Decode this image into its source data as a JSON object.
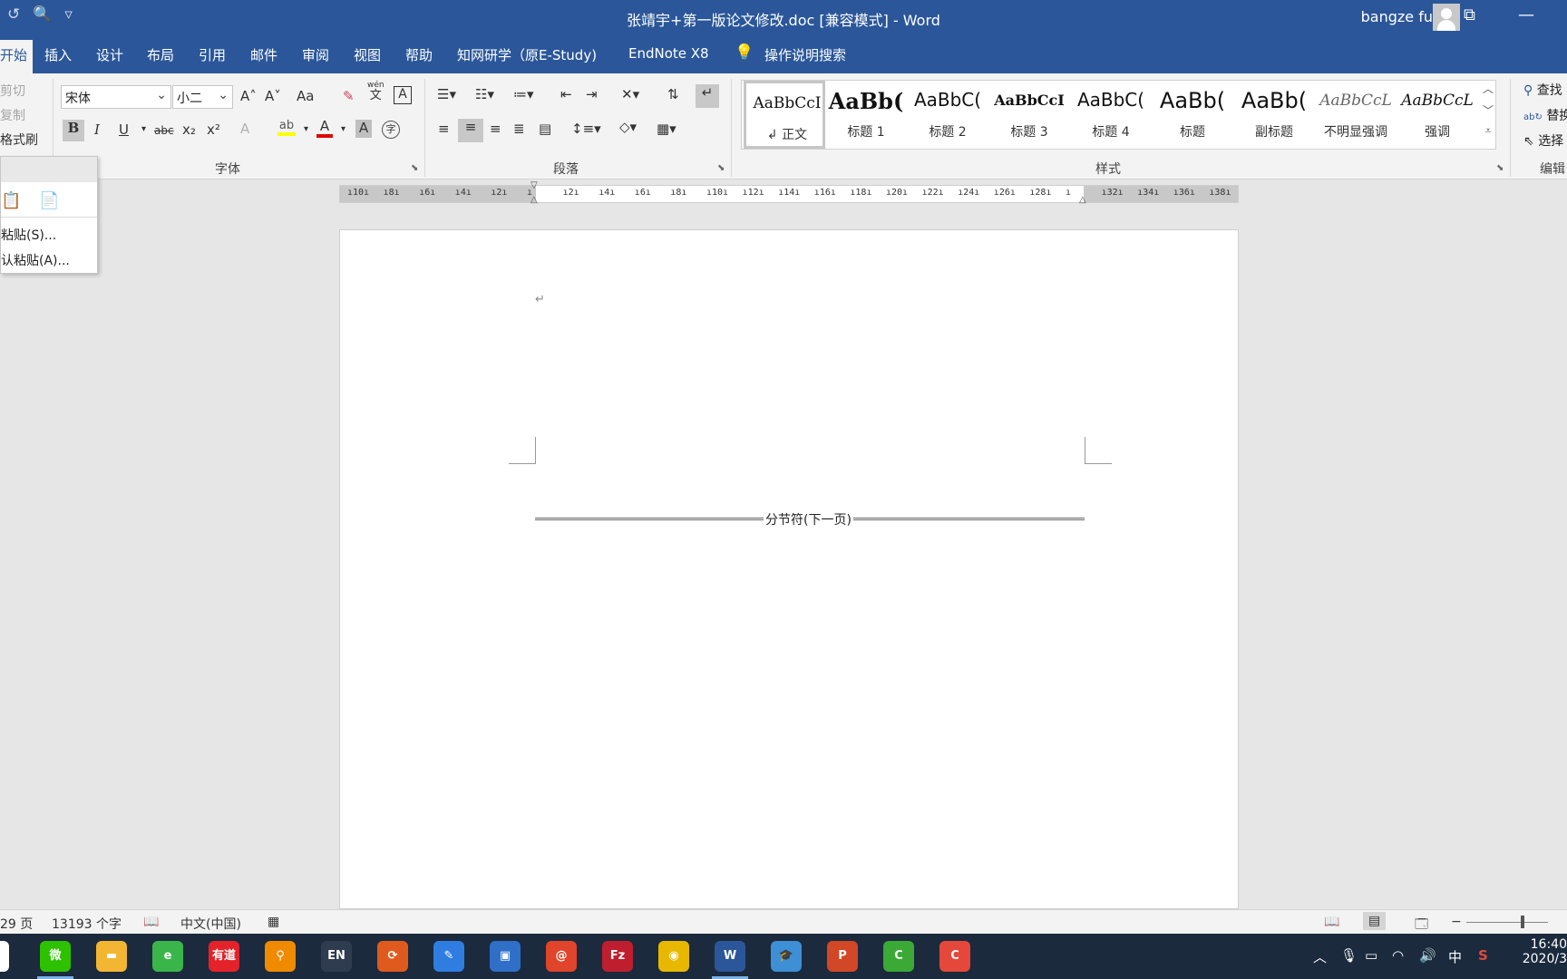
{
  "window": {
    "title": "张靖宇+第一版论文修改.doc [兼容模式]  -  Word",
    "user": "bangze fu",
    "restore_glyph": "⧉",
    "minimize_glyph": "—"
  },
  "qat": {
    "undo": "↺",
    "preview": "🔍",
    "more": "▿"
  },
  "tabs": {
    "home": "开始",
    "insert": "插入",
    "design": "设计",
    "layout": "布局",
    "references": "引用",
    "mailings": "邮件",
    "review": "审阅",
    "view": "视图",
    "help": "帮助",
    "cnki": "知网研学（原E-Study)",
    "endnote": "EndNote X8",
    "tell_me": "操作说明搜索"
  },
  "clipboard": {
    "cut": "剪切",
    "copy": "复制",
    "format_painter": "格式刷"
  },
  "font_group": {
    "label": "字体",
    "font_name": "宋体",
    "font_size": "小二",
    "grow": "A˄",
    "shrink": "A˅",
    "case": "Aa",
    "bold": "B",
    "italic": "I",
    "underline": "U",
    "strike": "abc",
    "subscript": "x₂",
    "superscript": "x²",
    "font_color_letter": "A",
    "char_border": "A",
    "pinyin_top": "wén",
    "pinyin_bottom": "文"
  },
  "paragraph_group": {
    "label": "段落"
  },
  "styles_group": {
    "label": "样式",
    "styles": [
      {
        "sample": "AaBbCcI",
        "name": "↲ 正文"
      },
      {
        "sample": "AaBb(",
        "name": "标题 1"
      },
      {
        "sample": "AaBbC(",
        "name": "标题 2"
      },
      {
        "sample": "AaBbCcI",
        "name": "标题 3"
      },
      {
        "sample": "AaBbC(",
        "name": "标题 4"
      },
      {
        "sample": "AaBb(",
        "name": "标题"
      },
      {
        "sample": "AaBb(",
        "name": "副标题"
      },
      {
        "sample": "AaBbCcL",
        "name": "不明显强调"
      },
      {
        "sample": "AaBbCcL",
        "name": "强调"
      }
    ]
  },
  "editing_group": {
    "label": "编辑",
    "find": "查找",
    "replace": "替换",
    "select": "选择"
  },
  "paste_menu": {
    "special": "粘贴(S)...",
    "default": "认粘贴(A)..."
  },
  "ruler": {
    "ticks": [
      "10",
      "8",
      "6",
      "4",
      "2",
      "",
      "2",
      "4",
      "6",
      "8",
      "10",
      "12",
      "14",
      "16",
      "18",
      "20",
      "22",
      "24",
      "26",
      "28",
      "",
      "32",
      "34",
      "36",
      "38"
    ]
  },
  "document": {
    "paragraph_mark": "↵",
    "section_break": "分节符(下一页)"
  },
  "status": {
    "page": "29 页",
    "words": "13193 个字",
    "language": "中文(中国)"
  },
  "taskbar": {
    "apps": [
      {
        "name": "wechat",
        "label": "微",
        "color": "#2dc100"
      },
      {
        "name": "explorer",
        "label": "▬",
        "color": "#f2b632"
      },
      {
        "name": "browser-360",
        "label": "e",
        "color": "#3ab54a"
      },
      {
        "name": "youdao",
        "label": "有道",
        "color": "#e3222a"
      },
      {
        "name": "search-app",
        "label": "⚲",
        "color": "#f08a00"
      },
      {
        "name": "en-input",
        "label": "EN",
        "color": "#2f3b4e"
      },
      {
        "name": "sync-app",
        "label": "⟳",
        "color": "#e05a1e"
      },
      {
        "name": "notes-app",
        "label": "✎",
        "color": "#2f7de1"
      },
      {
        "name": "remote-desktop",
        "label": "▣",
        "color": "#2f6fc7"
      },
      {
        "name": "spiral-app",
        "label": "@",
        "color": "#e0442a"
      },
      {
        "name": "filezilla",
        "label": "Fz",
        "color": "#bf1e2e"
      },
      {
        "name": "chrome",
        "label": "◉",
        "color": "#e8b800"
      },
      {
        "name": "word",
        "label": "W",
        "color": "#2b579a"
      },
      {
        "name": "edu-app",
        "label": "🎓",
        "color": "#3d8fd6"
      },
      {
        "name": "powerpoint",
        "label": "P",
        "color": "#d24726"
      },
      {
        "name": "camtasia-green",
        "label": "C",
        "color": "#3aa935"
      },
      {
        "name": "camtasia-red",
        "label": "C",
        "color": "#e5483a"
      }
    ],
    "tray_ime": "中",
    "time": "16:40",
    "date": "2020/3"
  }
}
